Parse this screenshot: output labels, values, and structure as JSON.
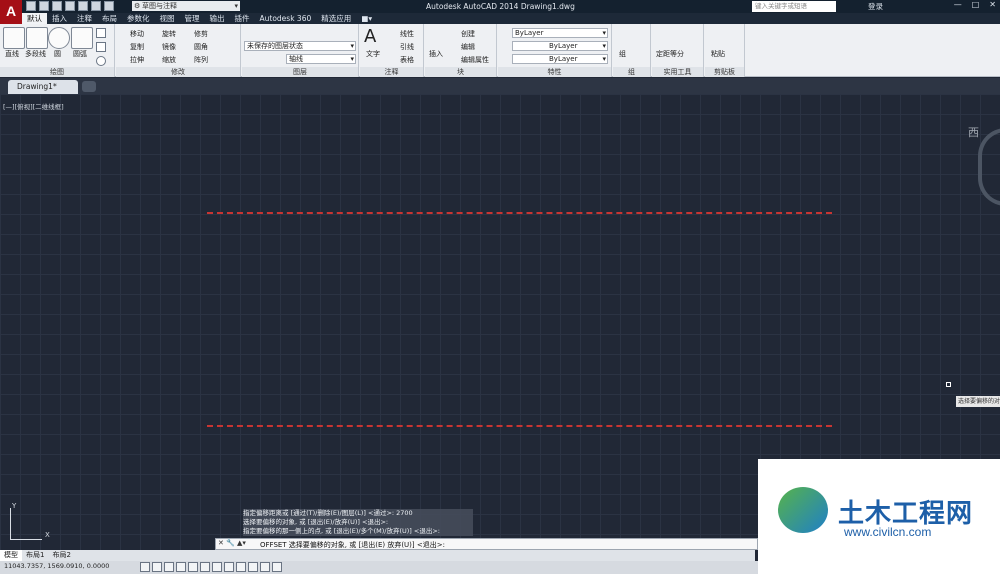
{
  "titlebar": {
    "logo": "A",
    "workspace": "草图与注释",
    "title": "Autodesk AutoCAD 2014 Drawing1.dwg",
    "search_placeholder": "键入关键字或短语",
    "login": "登录",
    "buttons": [
      "—",
      "□",
      "✕"
    ]
  },
  "tabs": [
    "默认",
    "插入",
    "注释",
    "布局",
    "参数化",
    "视图",
    "管理",
    "输出",
    "插件",
    "Autodesk 360",
    "精选应用",
    "■▾"
  ],
  "ribbon": {
    "draw": {
      "label": "绘图",
      "line": "直线",
      "polyline": "多段线",
      "circle": "圆",
      "arc": "圆弧"
    },
    "modify": {
      "label": "修改",
      "move": "移动",
      "rotate": "旋转",
      "trim": "修剪",
      "copy": "复制",
      "mirror": "镜像",
      "fillet": "圆角",
      "stretch": "拉伸",
      "scale": "缩放",
      "array": "阵列"
    },
    "layers": {
      "label": "图层",
      "state": "未保存的图层状态",
      "layer": "轴线"
    },
    "annotation": {
      "label": "注释",
      "text": "文字",
      "linear": "线性",
      "leader": "引线",
      "table": "表格"
    },
    "block": {
      "label": "块",
      "insert": "插入",
      "create": "创建",
      "edit": "编辑",
      "attrib": "编辑属性"
    },
    "properties": {
      "label": "特性",
      "color": "ByLayer",
      "linetype": "ByLayer",
      "lineweight": "ByLayer"
    },
    "groups": {
      "label": "组",
      "group": "组"
    },
    "utilities": {
      "label": "实用工具",
      "measure": "定距等分"
    },
    "clipboard": {
      "label": "剪贴板",
      "paste": "粘贴"
    }
  },
  "document": {
    "tab": "Drawing1*"
  },
  "viewport": {
    "label": "[—][俯视][二维线框]",
    "viewcube": "西",
    "tooltip": "选择要偏移的对"
  },
  "ucs": {
    "x": "X",
    "y": "Y"
  },
  "history": [
    "指定偏移距离或 [通过(T)/删除(E)/图层(L)] <通过>: 2700",
    "选择要偏移的对象, 或 [退出(E)/放弃(U)] <退出>:",
    "指定要偏移的那一侧上的点, 或 [退出(E)/多个(M)/放弃(U)] <退出>:"
  ],
  "command": {
    "icons": "✕ 🔧 ▲▾",
    "text": "OFFSET 选择要偏移的对象, 或 [退出(E) 放弃(U)] <退出>:"
  },
  "layouts": [
    "模型",
    "布局1",
    "布局2"
  ],
  "status": {
    "coords": "11043.7357, 1569.0910, 0.0000"
  },
  "watermark": {
    "title": "土木工程网",
    "url": "www.civilcn.com"
  }
}
